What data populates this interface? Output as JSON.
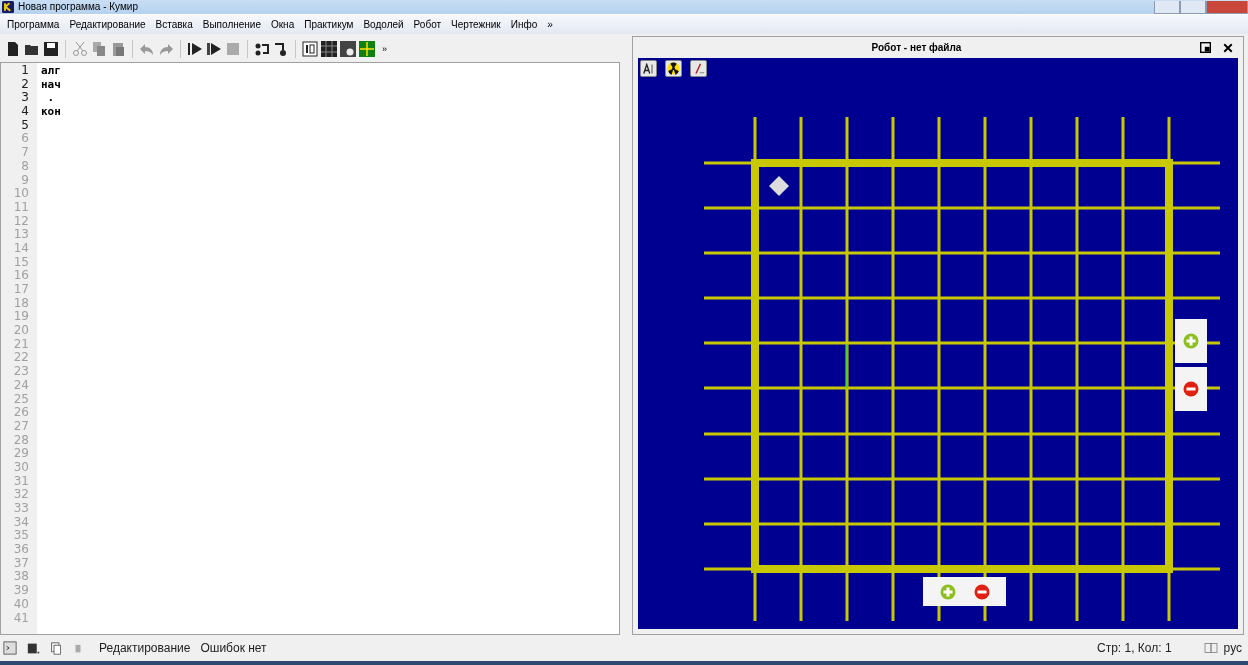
{
  "window": {
    "title": "Новая программа - Кумир"
  },
  "menu": [
    {
      "label": "Программа"
    },
    {
      "label": "Редактирование"
    },
    {
      "label": "Вставка"
    },
    {
      "label": "Выполнение"
    },
    {
      "label": "Окна"
    },
    {
      "label": "Практикум"
    },
    {
      "label": "Водолей"
    },
    {
      "label": "Робот"
    },
    {
      "label": "Чертежник"
    },
    {
      "label": "Инфо"
    },
    {
      "label": "»"
    }
  ],
  "toolbar": {
    "more": "»"
  },
  "editor": {
    "lines": [
      {
        "number": "1",
        "text": "алг",
        "dim": false
      },
      {
        "number": "2",
        "text": "нач",
        "dim": false
      },
      {
        "number": "3",
        "text": " .",
        "dim": false
      },
      {
        "number": "4",
        "text": "кон",
        "dim": false
      },
      {
        "number": "5",
        "dim": false
      },
      {
        "number": "6",
        "dim": true
      },
      {
        "number": "7",
        "dim": true
      },
      {
        "number": "8",
        "dim": true
      },
      {
        "number": "9",
        "dim": true
      },
      {
        "number": "10",
        "dim": true
      },
      {
        "number": "11",
        "dim": true
      },
      {
        "number": "12",
        "dim": true
      },
      {
        "number": "13",
        "dim": true
      },
      {
        "number": "14",
        "dim": true
      },
      {
        "number": "15",
        "dim": true
      },
      {
        "number": "16",
        "dim": true
      },
      {
        "number": "17",
        "dim": true
      },
      {
        "number": "18",
        "dim": true
      },
      {
        "number": "19",
        "dim": true
      },
      {
        "number": "20",
        "dim": true
      },
      {
        "number": "21",
        "dim": true
      },
      {
        "number": "22",
        "dim": true
      },
      {
        "number": "23",
        "dim": true
      },
      {
        "number": "24",
        "dim": true
      },
      {
        "number": "25",
        "dim": true
      },
      {
        "number": "26",
        "dim": true
      },
      {
        "number": "27",
        "dim": true
      },
      {
        "number": "28",
        "dim": true
      },
      {
        "number": "29",
        "dim": true
      },
      {
        "number": "30",
        "dim": true
      },
      {
        "number": "31",
        "dim": true
      },
      {
        "number": "32",
        "dim": true
      },
      {
        "number": "33",
        "dim": true
      },
      {
        "number": "34",
        "dim": true
      },
      {
        "number": "35",
        "dim": true
      },
      {
        "number": "36",
        "dim": true
      },
      {
        "number": "37",
        "dim": true
      },
      {
        "number": "38",
        "dim": true
      },
      {
        "number": "39",
        "dim": true
      },
      {
        "number": "40",
        "dim": true
      },
      {
        "number": "41",
        "dim": true
      }
    ]
  },
  "robot_panel": {
    "title": "Робот - нет файла"
  },
  "status_bar": {
    "mode": "Редактирование",
    "errors": "Ошибок нет",
    "position": "Стр: 1, Кол: 1",
    "language": "рус"
  }
}
